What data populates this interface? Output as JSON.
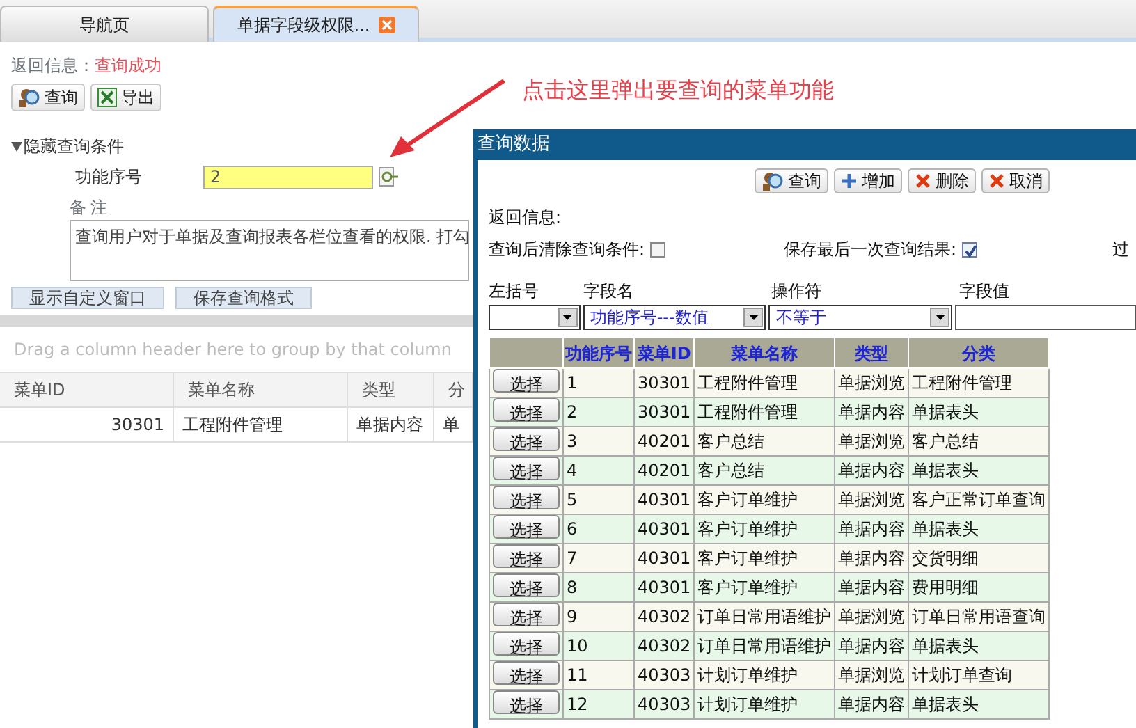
{
  "tabs": [
    {
      "label": "导航页",
      "selected": false,
      "closable": false
    },
    {
      "label": "单据字段级权限...",
      "selected": true,
      "closable": true
    }
  ],
  "return_info": {
    "label": "返回信息：",
    "value": "查询成功"
  },
  "toolbar": [
    {
      "kind": "search",
      "label": "查询"
    },
    {
      "kind": "excel",
      "label": "导出"
    }
  ],
  "conditions": {
    "toggle": "隐藏查询条件",
    "expanded": true,
    "function_no": {
      "label": "功能序号",
      "value": "2"
    },
    "remark": {
      "label": "备注",
      "value": "查询用户对于单据及查询报表各栏位查看的权限. 打勾"
    }
  },
  "actions": [
    "显示自定义窗口",
    "保存查询格式"
  ],
  "grid": {
    "group_hint": "Drag a column header here to group by that column",
    "columns": [
      "菜单ID",
      "菜单名称",
      "类型",
      "分"
    ],
    "rows": [
      [
        "30301",
        "工程附件管理",
        "单据内容",
        "单"
      ]
    ]
  },
  "annotation": "点击这里弹出要查询的菜单功能",
  "dialog": {
    "title": "查询数据",
    "buttons": [
      {
        "kind": "search",
        "label": "查询"
      },
      {
        "kind": "add",
        "label": "增加"
      },
      {
        "kind": "delete",
        "label": "删除"
      },
      {
        "kind": "cancel",
        "label": "取消"
      }
    ],
    "return_label": "返回信息:",
    "options": [
      {
        "label": "查询后清除查询条件:",
        "checked": false
      },
      {
        "label": "保存最后一次查询结果:",
        "checked": true
      }
    ],
    "cut_label": "过",
    "filter": {
      "labels": [
        "左括号",
        "字段名",
        "操作符",
        "字段值"
      ],
      "field": "功能序号---数值",
      "operator": "不等于"
    },
    "table": {
      "columns": [
        "功能序号",
        "菜单ID",
        "菜单名称",
        "类型",
        "分类"
      ],
      "rows": [
        {
          "button": "选择",
          "cells": [
            "1",
            "30301",
            "工程附件管理",
            "单据浏览",
            "工程附件管理"
          ]
        },
        {
          "button": "选择",
          "cells": [
            "2",
            "30301",
            "工程附件管理",
            "单据内容",
            "单据表头"
          ]
        },
        {
          "button": "选择",
          "cells": [
            "3",
            "40201",
            "客户总结",
            "单据浏览",
            "客户总结"
          ]
        },
        {
          "button": "选择",
          "cells": [
            "4",
            "40201",
            "客户总结",
            "单据内容",
            "单据表头"
          ]
        },
        {
          "button": "选择",
          "cells": [
            "5",
            "40301",
            "客户订单维护",
            "单据浏览",
            "客户正常订单查询"
          ]
        },
        {
          "button": "选择",
          "cells": [
            "6",
            "40301",
            "客户订单维护",
            "单据内容",
            "单据表头"
          ]
        },
        {
          "button": "选择",
          "cells": [
            "7",
            "40301",
            "客户订单维护",
            "单据内容",
            "交货明细"
          ]
        },
        {
          "button": "选择",
          "cells": [
            "8",
            "40301",
            "客户订单维护",
            "单据内容",
            "费用明细"
          ]
        },
        {
          "button": "选择",
          "cells": [
            "9",
            "40302",
            "订单日常用语维护",
            "单据浏览",
            "订单日常用语查询"
          ]
        },
        {
          "button": "选择",
          "cells": [
            "10",
            "40302",
            "订单日常用语维护",
            "单据内容",
            "单据表头"
          ]
        },
        {
          "button": "选择",
          "cells": [
            "11",
            "40303",
            "计划订单维护",
            "单据浏览",
            "计划订单查询"
          ]
        },
        {
          "button": "选择",
          "cells": [
            "12",
            "40303",
            "计划订单维护",
            "单据内容",
            "单据表头"
          ]
        }
      ]
    }
  }
}
